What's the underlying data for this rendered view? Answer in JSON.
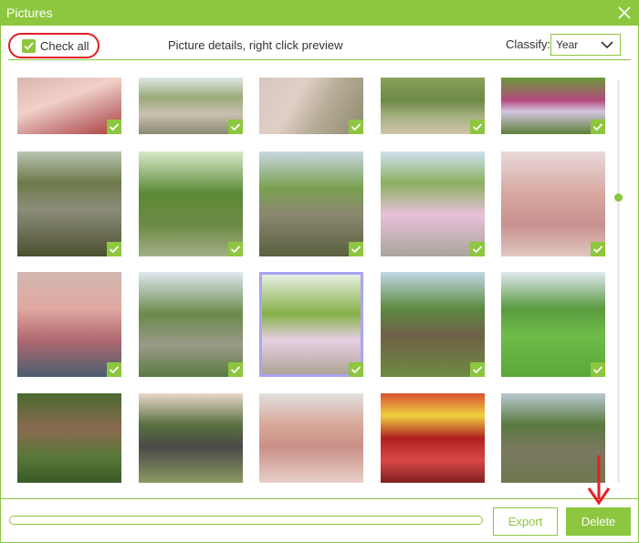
{
  "window": {
    "title": "Pictures"
  },
  "toolbar": {
    "check_all_label": "Check all",
    "hint": "Picture details, right click preview",
    "classify_label": "Classify:",
    "classify_value": "Year"
  },
  "photos": [
    {
      "bg": "linear-gradient(160deg,#d9b7b0,#f0d0c8 40%,#c98585 70%,#b0403c)",
      "selected": false
    },
    {
      "bg": "linear-gradient(180deg,#dfe6e8 0%,#9aaa78 35%,#c9c0b0 65%,#8a8a70)",
      "selected": false
    },
    {
      "bg": "linear-gradient(120deg,#d8c6c0 0%,#e0cfc6 35%,#b8ad98 60%,#8d8a6f)",
      "selected": false
    },
    {
      "bg": "linear-gradient(180deg,#8aa05a 0%,#6d8a45 40%,#a8b285 70%,#d0c4a8)",
      "selected": false
    },
    {
      "bg": "linear-gradient(180deg,#6a9a3a 0%,#b44a7e 40%,#d4c6e0 60%,#5e7e3a)",
      "selected": false
    },
    {
      "bg": "linear-gradient(180deg,#b8c4b0 0%,#6e7a4a 30%,#8c8c7a 55%,#4c5030)",
      "selected": false
    },
    {
      "bg": "linear-gradient(180deg,#d8e8c8 0%,#5a8a35 40%,#6d8a45 70%,#a2b085)",
      "selected": false
    },
    {
      "bg": "linear-gradient(180deg,#c8d8e0 0%,#7aa050 35%,#8b8770 60%,#5a6040)",
      "selected": false
    },
    {
      "bg": "linear-gradient(180deg,#d0e0f0 0%,#8ab060 30%,#e8c0d8 60%,#a8a69a)",
      "selected": false
    },
    {
      "bg": "linear-gradient(180deg,#e8dada 0%,#d8a8a0 40%,#c89090 70%,#e0c8c0)",
      "selected": false
    },
    {
      "bg": "linear-gradient(180deg,#d0b8b0 0%,#e0a8a0 35%,#b06870 65%,#4a5e70)",
      "selected": false
    },
    {
      "bg": "linear-gradient(180deg,#e0e8f0 0%,#6a8a4a 40%,#9a9a88 70%,#5a7a40)",
      "selected": false
    },
    {
      "bg": "linear-gradient(180deg,#eef4ee 0%,#86b048 40%,#e8d0e4 65%,#a8a08e)",
      "selected": true
    },
    {
      "bg": "linear-gradient(180deg,#c0d8e8 0%,#5d8a40 35%,#6f6148 60%,#6e8a40)",
      "selected": false
    },
    {
      "bg": "linear-gradient(180deg,#e0e8f0 0%,#5a9a40 35%,#6dbb48 60%,#5aa83a)",
      "selected": false
    },
    {
      "bg": "linear-gradient(180deg,#4a6a30 0%,#8a6a50 40%,#5a7838 70%,#3a5a28)",
      "selected": false
    },
    {
      "bg": "linear-gradient(180deg,#e8d8c8 0%,#5a7040 35%,#4a4a48 60%,#8a9a60)",
      "selected": false
    },
    {
      "bg": "linear-gradient(180deg,#e0e0e0 0%,#d8a898 35%,#c89088 60%,#e8d0c8)",
      "selected": false
    },
    {
      "bg": "linear-gradient(180deg,#d85030 0%,#f0d040 25%,#b02020 50%,#d84848 75%,#802020)",
      "selected": false
    },
    {
      "bg": "linear-gradient(180deg,#b8c8d0 0%,#5a7a40 35%,#7a7860 65%,#6e7850)",
      "selected": false
    }
  ],
  "footer": {
    "export_label": "Export",
    "delete_label": "Delete",
    "progress": 0
  }
}
